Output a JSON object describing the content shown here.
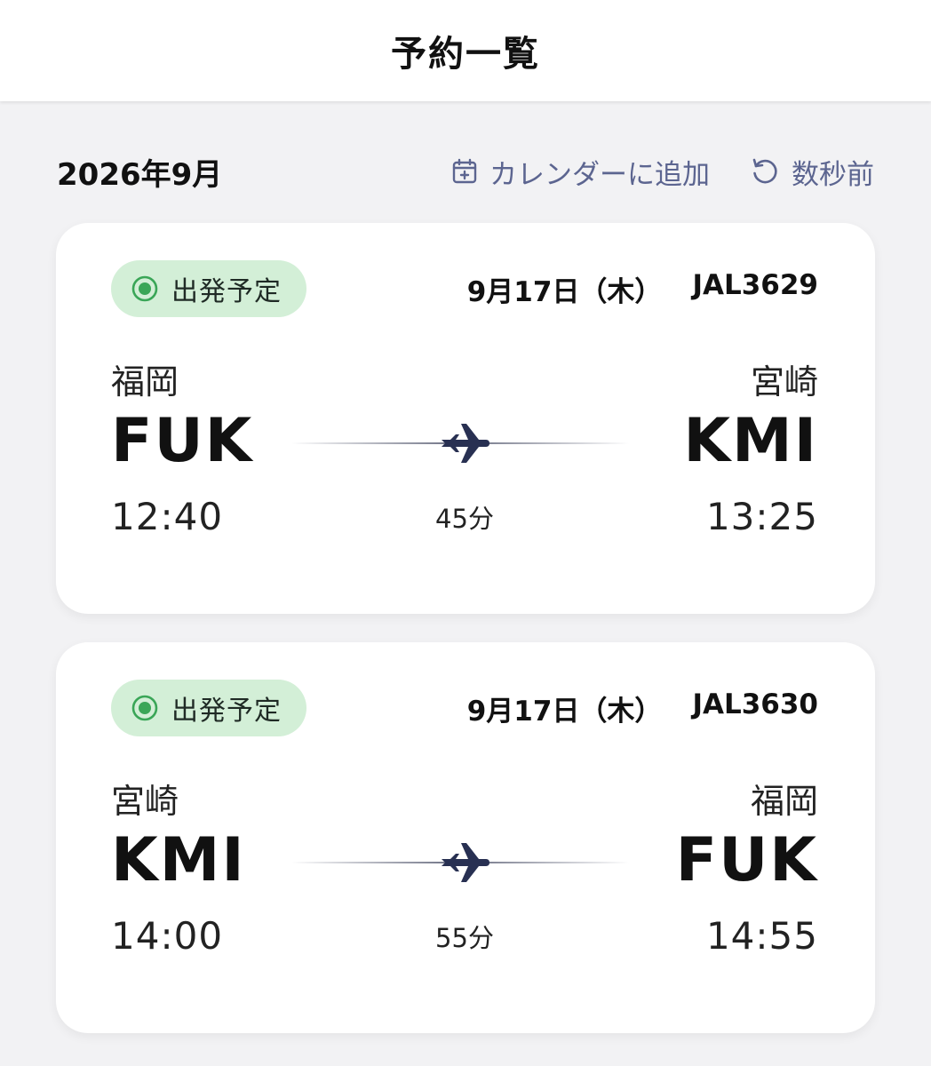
{
  "header": {
    "title": "予約一覧"
  },
  "section": {
    "month": "2026年9月",
    "add_to_calendar": {
      "label": "カレンダーに追加",
      "icon": "calendar-add-icon"
    },
    "refresh": {
      "label": "数秒前",
      "icon": "refresh-icon"
    }
  },
  "colors": {
    "accent": "#5c6590",
    "badge_bg": "#d3efd7",
    "badge_icon": "#3aa657",
    "plane": "#283052"
  },
  "flights": [
    {
      "status": "出発予定",
      "date": "9月17日（木）",
      "flight_no": "JAL3629",
      "origin": {
        "city": "福岡",
        "code": "FUK",
        "time": "12:40"
      },
      "destination": {
        "city": "宮崎",
        "code": "KMI",
        "time": "13:25"
      },
      "duration": "45分"
    },
    {
      "status": "出発予定",
      "date": "9月17日（木）",
      "flight_no": "JAL3630",
      "origin": {
        "city": "宮崎",
        "code": "KMI",
        "time": "14:00"
      },
      "destination": {
        "city": "福岡",
        "code": "FUK",
        "time": "14:55"
      },
      "duration": "55分"
    }
  ]
}
